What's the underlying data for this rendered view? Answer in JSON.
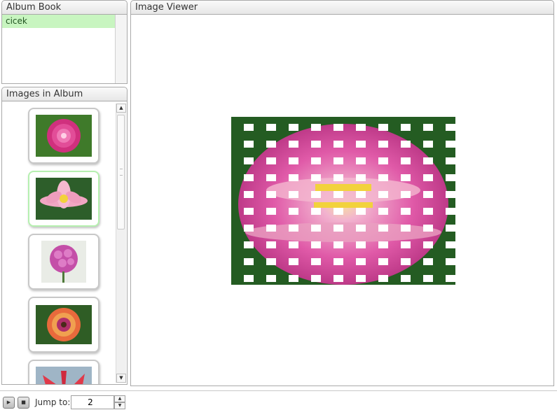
{
  "album_book": {
    "title": "Album Book",
    "albums": [
      {
        "label": "cicek",
        "selected": true
      }
    ]
  },
  "images_in_album": {
    "title": "Images in Album",
    "thumbnails": [
      {
        "name": "pink dahlia",
        "selected": false
      },
      {
        "name": "pink lotus",
        "selected": true
      },
      {
        "name": "pink phlox cluster",
        "selected": false
      },
      {
        "name": "orange gazania",
        "selected": false
      },
      {
        "name": "red fuchsia",
        "selected": false
      }
    ]
  },
  "image_viewer": {
    "title": "Image Viewer",
    "transition_effect": "checkerboard"
  },
  "footer": {
    "play_icon": "play-icon",
    "stop_icon": "stop-icon",
    "jump_label": "Jump to:",
    "jump_value": "2"
  },
  "colors": {
    "selection_green": "#c8f5c0",
    "selected_thumb_border": "#b6f0b0",
    "panel_border": "#a9a9a9"
  }
}
